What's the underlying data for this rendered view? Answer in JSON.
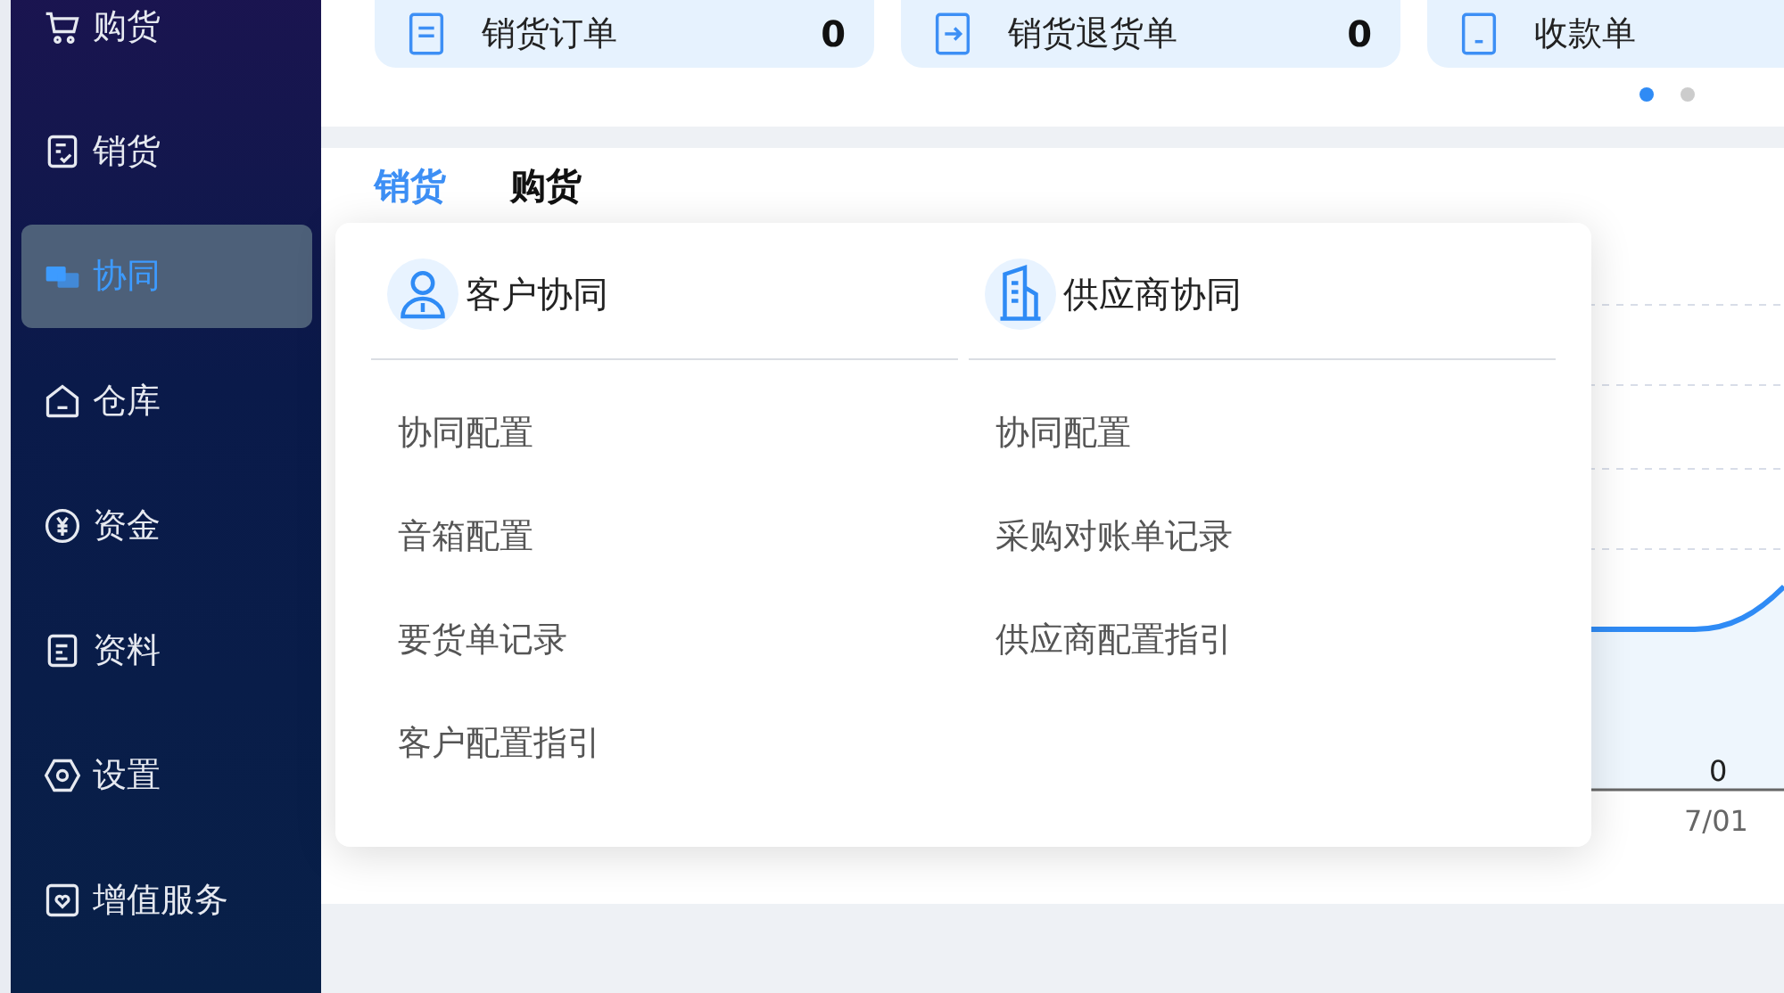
{
  "sidebar": {
    "items": [
      {
        "label": "购货",
        "selected": false
      },
      {
        "label": "销货",
        "selected": false
      },
      {
        "label": "协同",
        "selected": true
      },
      {
        "label": "仓库",
        "selected": false
      },
      {
        "label": "资金",
        "selected": false
      },
      {
        "label": "资料",
        "selected": false
      },
      {
        "label": "设置",
        "selected": false
      },
      {
        "label": "增值服务",
        "selected": false
      }
    ]
  },
  "summary_cards": [
    {
      "label": "销货订单",
      "value": "0"
    },
    {
      "label": "销货退货单",
      "value": "0"
    },
    {
      "label": "收款单"
    }
  ],
  "carousel_dots": [
    {
      "selected": true
    },
    {
      "selected": false
    }
  ],
  "tabs": [
    {
      "label": "销货",
      "selected": true
    },
    {
      "label": "购货",
      "selected": false
    }
  ],
  "chart": {
    "point_label": "0",
    "x_label": "7/01"
  },
  "popup": {
    "columns": [
      {
        "title": "客户协同",
        "items": [
          "协同配置",
          "音箱配置",
          "要货单记录",
          "客户配置指引"
        ]
      },
      {
        "title": "供应商协同",
        "items": [
          "协同配置",
          "采购对账单记录",
          "供应商配置指引"
        ]
      }
    ]
  }
}
